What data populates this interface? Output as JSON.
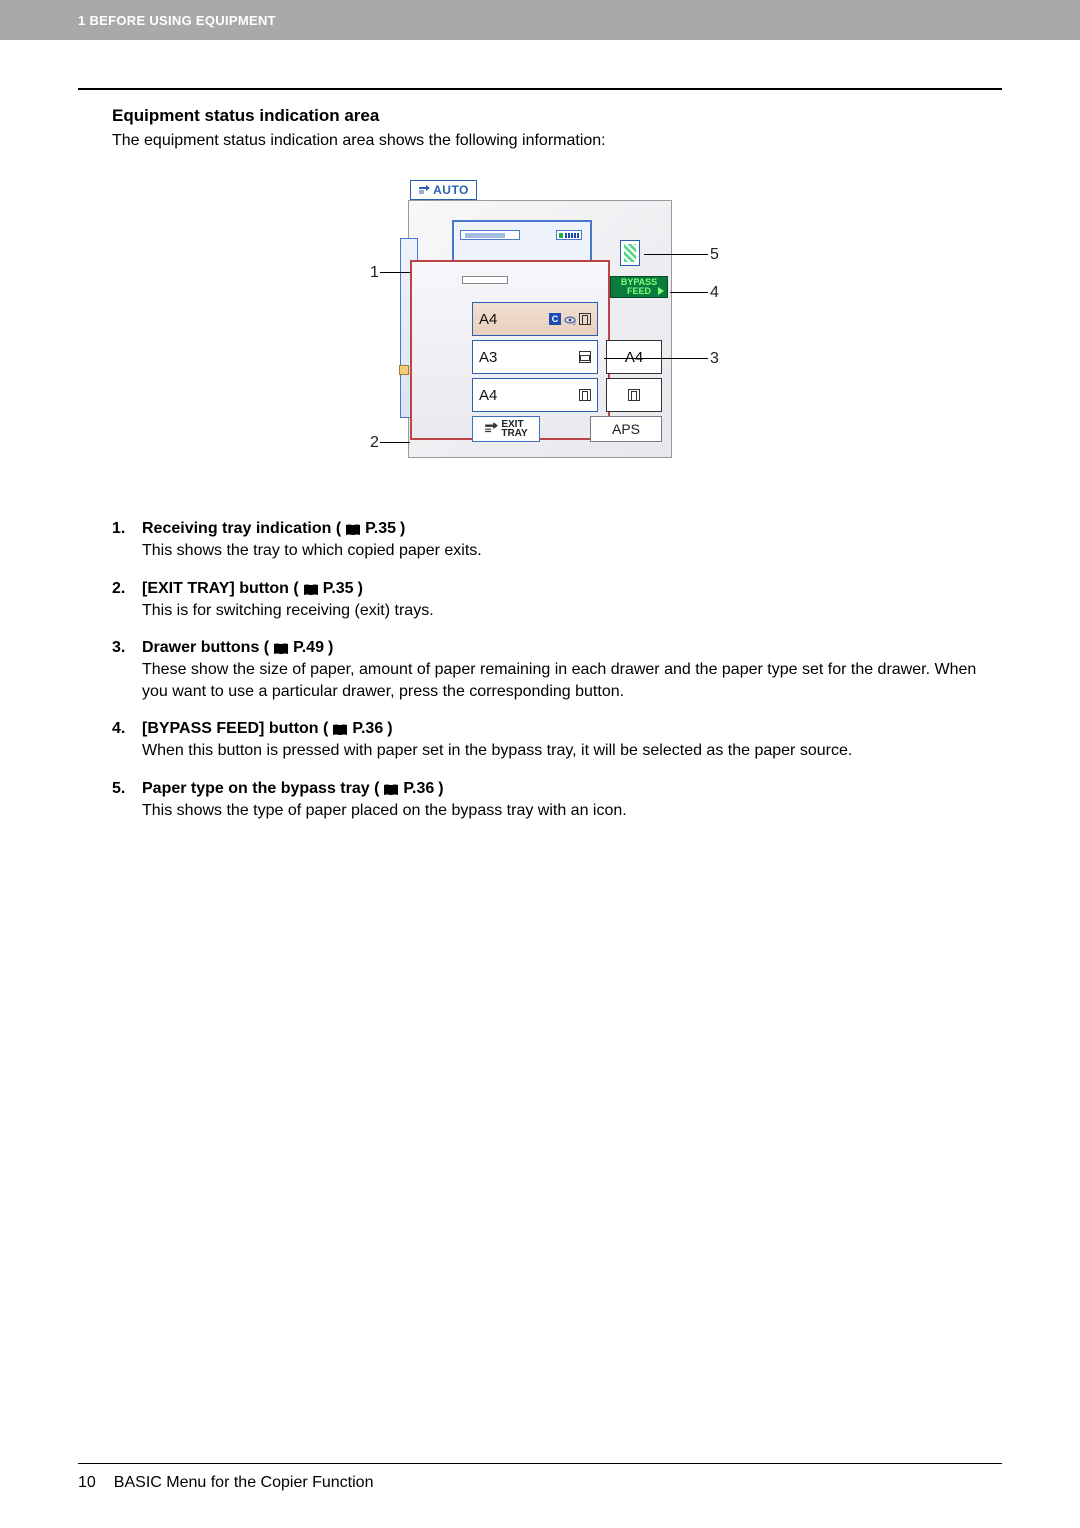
{
  "header": {
    "chapter": "1 BEFORE USING EQUIPMENT"
  },
  "section": {
    "title": "Equipment status indication area",
    "intro": "The equipment status indication area shows the following information:"
  },
  "diagram": {
    "auto_label": "AUTO",
    "drawers": [
      {
        "size": "A4"
      },
      {
        "size": "A3"
      },
      {
        "size": "A4"
      }
    ],
    "side_drawer": "A4",
    "bypass_top": "BYPASS",
    "bypass_bottom": "FEED",
    "exit_tray_label": "EXIT\nTRAY",
    "aps_label": "APS",
    "callouts": [
      "1",
      "2",
      "3",
      "4",
      "5"
    ]
  },
  "items": [
    {
      "num": "1.",
      "title_before": "Receiving tray indication (",
      "page": "P.35",
      "title_after": ")",
      "desc": "This shows the tray to which copied paper exits."
    },
    {
      "num": "2.",
      "title_before": "[EXIT TRAY] button (",
      "page": "P.35",
      "title_after": ")",
      "desc": "This is for switching receiving (exit) trays."
    },
    {
      "num": "3.",
      "title_before": "Drawer buttons (",
      "page": "P.49",
      "title_after": ")",
      "desc": "These show the size of paper, amount of paper remaining in each drawer and the paper type set for the drawer. When you want to use a particular drawer, press the corresponding button."
    },
    {
      "num": "4.",
      "title_before": "[BYPASS FEED] button (",
      "page": "P.36",
      "title_after": ")",
      "desc": "When this button is pressed with paper set in the bypass tray, it will be selected as the paper source."
    },
    {
      "num": "5.",
      "title_before": "Paper type on the bypass tray (",
      "page": "P.36",
      "title_after": ")",
      "desc": "This shows the type of paper placed on the bypass tray with an icon."
    }
  ],
  "footer": {
    "page_number": "10",
    "footer_title": "BASIC Menu for the Copier Function"
  }
}
